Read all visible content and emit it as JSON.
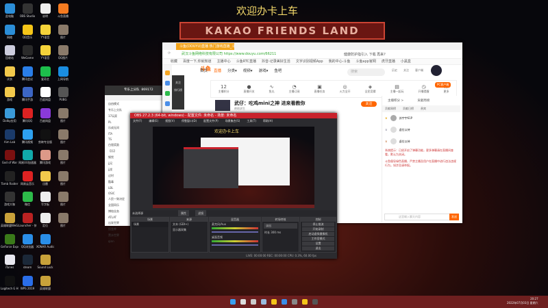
{
  "banner": "欢迎办卡上车",
  "sign": "KAKAO FRIENDS LAND",
  "desktop_icons": [
    {
      "label": "此电脑",
      "color": "#2b8ed8"
    },
    {
      "label": "OBS Studio",
      "color": "#333"
    },
    {
      "label": "说明",
      "color": "#eee"
    },
    {
      "label": "斗鱼直播",
      "color": "#f47a20"
    },
    {
      "label": "网络",
      "color": "#2b8ed8"
    },
    {
      "label": "QQ音乐",
      "color": "#f5c518"
    },
    {
      "label": "YY语音",
      "color": "#f5d33a"
    },
    {
      "label": "图片",
      "color": "#8a7a6a"
    },
    {
      "label": "回收站",
      "color": "#ccd"
    },
    {
      "label": "WeGame",
      "color": "#2a2a2a"
    },
    {
      "label": "YY语音",
      "color": "#f5d33a"
    },
    {
      "label": "QQ图片",
      "color": "#8a7a6a"
    },
    {
      "label": "试衣",
      "color": "#f2c94c"
    },
    {
      "label": "腾讯会议",
      "color": "#2a7ee8"
    },
    {
      "label": "爱奇艺",
      "color": "#1dbf4c"
    },
    {
      "label": "上网导航",
      "color": "#1a8de0"
    },
    {
      "label": "游戏",
      "color": "#f2c94c"
    },
    {
      "label": "腾讯手游",
      "color": "#3c66c4"
    },
    {
      "label": "百度网盘",
      "color": "#fff"
    },
    {
      "label": "PUBG",
      "color": "#555"
    },
    {
      "label": "Dolby应用",
      "color": "#3a9ad9"
    },
    {
      "label": "腾讯QQ",
      "color": "#d22"
    },
    {
      "label": "百度网盘",
      "color": "#8a3ad9"
    },
    {
      "label": "图片",
      "color": "#8a7a6a"
    },
    {
      "label": "Aim Lab",
      "color": "#1a3a6a"
    },
    {
      "label": "腾讯视频",
      "color": "#2da0f0"
    },
    {
      "label": "剪映专业版",
      "color": "#111"
    },
    {
      "label": "图片",
      "color": "#8a7a6a"
    },
    {
      "label": "God of War",
      "color": "#7a1010"
    },
    {
      "label": "网易UU加速器",
      "color": "#1aa"
    },
    {
      "label": "腾讯游戏",
      "color": "#d98"
    },
    {
      "label": "图片",
      "color": "#8a7a6a"
    },
    {
      "label": "Tomb Raider",
      "color": "#222"
    },
    {
      "label": "网易云音乐",
      "color": "#d22"
    },
    {
      "label": "迅雷",
      "color": "#f2c94c"
    },
    {
      "label": "图片",
      "color": "#8a7a6a"
    },
    {
      "label": "游戏大咖",
      "color": "#333"
    },
    {
      "label": "微信",
      "color": "#2dbb4a"
    },
    {
      "label": "写字板",
      "color": "#eee"
    },
    {
      "label": "图片",
      "color": "#8a7a6a"
    },
    {
      "label": "英雄联盟WeGame版",
      "color": "#c9a23a"
    },
    {
      "label": "Launcher - 快捷方式",
      "color": "#b22"
    },
    {
      "label": "定位",
      "color": "#eee"
    },
    {
      "label": "图片",
      "color": "#8a7a6a"
    },
    {
      "label": "GeForce Experience",
      "color": "#3a7a1a"
    },
    {
      "label": "QQ浏览器",
      "color": "#2a8ee8"
    },
    {
      "label": "XONAR Audio",
      "color": "#2a8ee8"
    },
    {
      "label": "",
      "color": "transparent"
    },
    {
      "label": "iTunes",
      "color": "#e8e8f0"
    },
    {
      "label": "steam",
      "color": "#1b2838"
    },
    {
      "label": "Sound Lock",
      "color": "#c9a23a"
    },
    {
      "label": "",
      "color": "transparent"
    },
    {
      "label": "Logitech G HUB",
      "color": "#111"
    },
    {
      "label": "WPS 2019",
      "color": "#2a6ee8"
    },
    {
      "label": "英雄联盟",
      "color": "#c9a23a"
    },
    {
      "label": "",
      "color": "transparent"
    }
  ],
  "browser": {
    "tab": "斗鱼(DOUYU)直播 热门游戏直播_斗鱼",
    "security": "武汉斗鱼网络科技有限公司",
    "url": "https://www.douyu.com/66211",
    "search_hint": "健康防护指引入 下载 再来?",
    "bookmarks": [
      "收藏",
      "百度一下,你就知道",
      "主播中心",
      "斗鱼RTC直播",
      "抖音-记录美好生活",
      "文字识别视频App",
      "我的中心-斗鱼",
      "斗鱼app官网",
      "虎牙直播",
      "小黑盒"
    ],
    "logo": "斗鱼",
    "nav": [
      "首页",
      "直播",
      "分类▾",
      "视频▾",
      "游戏▾",
      "鱼吧"
    ],
    "search_placeholder": "搜索",
    "header_icons": [
      "历史",
      "关注",
      "客户端"
    ],
    "tools": [
      {
        "top": "12",
        "label": "主播积分"
      },
      {
        "top": "●",
        "label": "直播开关"
      },
      {
        "top": "∿",
        "label": "鱼丸"
      },
      {
        "top": "◔",
        "label": "主播订阅"
      },
      {
        "top": "▣",
        "label": "直播任务"
      },
      {
        "top": "◎",
        "label": "火力全开"
      },
      {
        "top": "◈",
        "label": "全民竞猜"
      },
      {
        "top": "▤",
        "label": "主播一起玩"
      },
      {
        "top": "◷",
        "label": "开播提醒"
      },
      {
        "top": "…",
        "label": "更多"
      }
    ],
    "pc_badge": "PC客户端",
    "room_title": "武仔：吃鸡mini之神 进来看教你",
    "room_sub": "绝地求生",
    "follow": "关注",
    "sidebar": [
      "关注",
      "排行榜"
    ]
  },
  "chat": {
    "tabs": [
      "主播积分 >",
      "贡献周榜"
    ],
    "subtabs": [
      "贡献周榜",
      "贡献日榜",
      "贵宾"
    ],
    "users": [
      "苏宇宇61P",
      "虚位以待",
      "虚位以待"
    ],
    "system": "系统提示：已经开启了弹幕功能，更多弹幕请在直播间查看，默认为关闭。",
    "notice": "斗鱼倡导绿色直播，严禁主播及用户在直播中进行违法违规行为，如涉及请举报。",
    "input_placeholder": "这里输入聊天内容",
    "send": "发送"
  },
  "qq": {
    "name": "专乐上分队",
    "id": "869172",
    "rows": [
      "自由模式",
      "专乐上分队",
      "17玩家",
      "PL",
      "乐成无间",
      "ITA",
      "TS",
      "白银奖励",
      "【乐】",
      "钢兜",
      "jj兄",
      "jj发",
      "过时",
      "酷毒",
      "LBL",
      "OSIC",
      "人民一致决定",
      "全国同乐",
      "博铂业务",
      "ATLAT",
      "出发世界",
      "投金库",
      "黑水世界",
      "qinn"
    ]
  },
  "obs": {
    "title": "OBS 27.2.3 (64-bit, windows) - 配置文件: 未命名 - 场景: 未命名",
    "menu": [
      "文件(F)",
      "编辑(E)",
      "视图(V)",
      "停靠窗口(D)",
      "配置文件(P)",
      "场景集合(S)",
      "工具(T)",
      "帮助(H)"
    ],
    "no_source": "未选择源",
    "props": "属性",
    "filters": "滤镜",
    "docks": {
      "scenes": "场景",
      "sources": "来源",
      "mixer": "混音器",
      "transitions": "转场特效",
      "controls": "控制"
    },
    "scenes": [
      "场景"
    ],
    "sources": [
      "文本 (GDI+)",
      "显示器采集"
    ],
    "mixer": [
      {
        "name": "麦克风/Aux",
        "db": "0.0 dB",
        "level": 0.85
      },
      {
        "name": "桌面音频",
        "db": "0.0 dB",
        "level": 0.8
      }
    ],
    "transition": "淡出",
    "duration_label": "时长",
    "duration": "300 ms",
    "controls": [
      "停止推流",
      "开始录制",
      "启动虚拟摄像机",
      "工作室模式",
      "设置",
      "退出"
    ],
    "status": "LIVE: 00:00:00   REC: 00:00:00   CPU: 0.3%, 60.00 fps",
    "preview_banner": "欢迎办卡上车"
  },
  "taskbar": {
    "time": "20:27",
    "date": "2022年07月03日 星期六",
    "icons": [
      {
        "name": "start",
        "color": "#3aa0f0"
      },
      {
        "name": "search",
        "color": "#ddd"
      },
      {
        "name": "task-view",
        "color": "#ccc"
      },
      {
        "name": "steam",
        "color": "#9bd"
      },
      {
        "name": "yy",
        "color": "#f5c518"
      },
      {
        "name": "qq-browser",
        "color": "#3a8ee8"
      },
      {
        "name": "obs",
        "color": "#888"
      },
      {
        "name": "yy2",
        "color": "#f5c518"
      },
      {
        "name": "obs-live",
        "color": "#555"
      }
    ]
  }
}
